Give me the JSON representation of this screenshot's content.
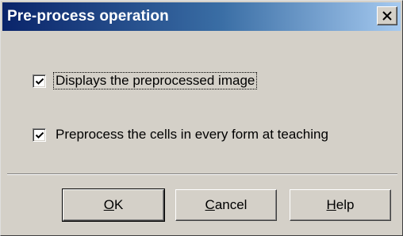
{
  "window": {
    "title": "Pre-process operation",
    "close_icon": "close-icon"
  },
  "options": [
    {
      "label": "Displays the preprocessed image",
      "checked": true
    },
    {
      "label": "Preprocess the cells in every form at teaching",
      "checked": true
    }
  ],
  "buttons": {
    "ok": {
      "mnemonic": "O",
      "rest": "K"
    },
    "cancel": {
      "mnemonic": "C",
      "rest": "ancel"
    },
    "help": {
      "mnemonic": "H",
      "rest": "elp"
    }
  },
  "colors": {
    "face": "#d4d0c8",
    "title_start": "#0a246a",
    "title_end": "#a6caf0"
  }
}
